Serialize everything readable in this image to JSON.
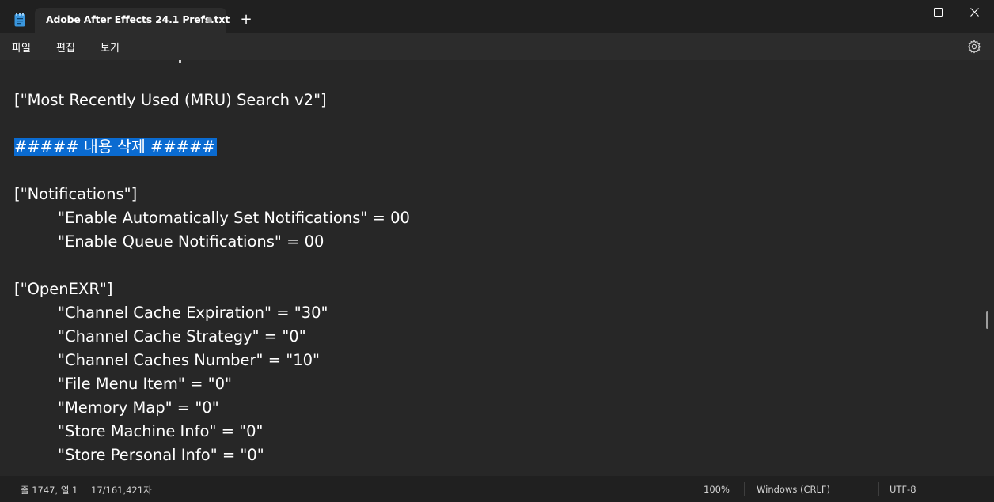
{
  "tab": {
    "title": "Adobe After Effects 24.1 Prefs.txt",
    "new_tab": "+"
  },
  "menu": {
    "file": "파일",
    "edit": "편집",
    "view": "보기"
  },
  "editor": {
    "lines": [
      "[\"Most Recently Used (MRU) Search v2\"]",
      "##### 내용 삭제 #####",
      "[\"Notifications\"]",
      "\"Enable Automatically Set Notifications\" = 00",
      "\"Enable Queue Notifications\" = 00",
      "[\"OpenEXR\"]",
      "\"Channel Cache Expiration\" = \"30\"",
      "\"Channel Cache Strategy\" = \"0\"",
      "\"Channel Caches Number\" = \"10\"",
      "\"File Menu Item\" = \"0\"",
      "\"Memory Map\" = \"0\"",
      "\"Store Machine Info\" = \"0\"",
      "\"Store Personal Info\" = \"0\""
    ],
    "selection_color": "#0a6bd1"
  },
  "status": {
    "position": "줄 1747, 열 1",
    "chars": "17/161,421자",
    "zoom": "100%",
    "line_ending": "Windows (CRLF)",
    "encoding": "UTF-8"
  }
}
